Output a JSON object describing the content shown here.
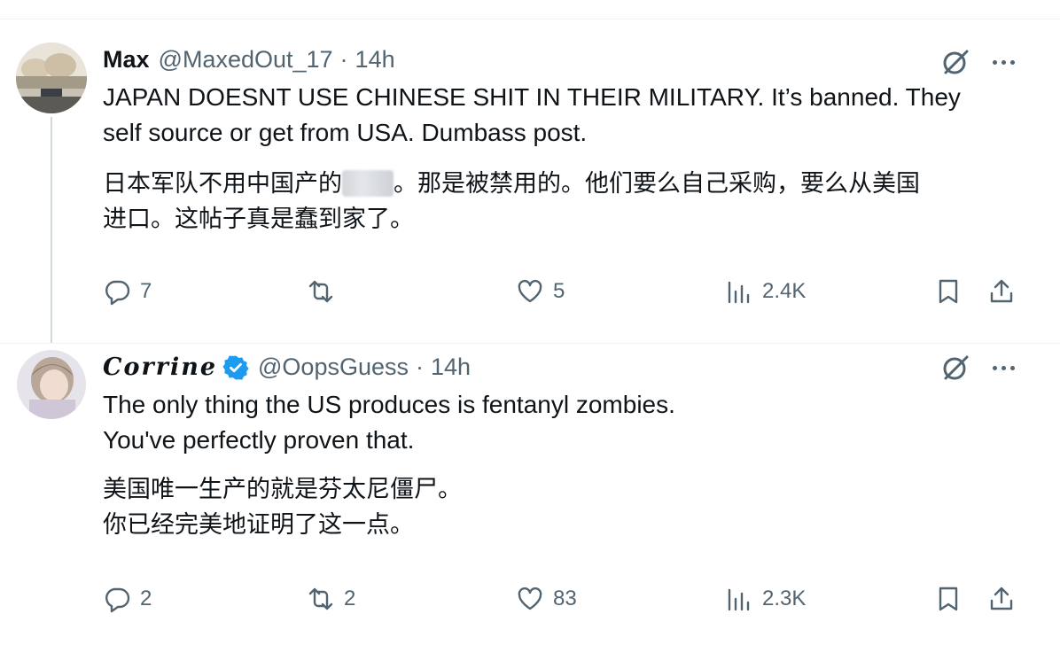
{
  "tweets": [
    {
      "name": "Max",
      "handle": "@MaxedOut_17",
      "separator": "·",
      "time": "14h",
      "verified": false,
      "text_en_lines": [
        "JAPAN DOESNT USE CHINESE SHIT IN THEIR MILITARY. It’s banned. They",
        "self source or get from USA. Dumbass post."
      ],
      "text_zh_part1": "日本军队不用中国产的",
      "text_zh_part2": "。那是被禁用的。他们要么自己采购，要么从美国",
      "text_zh_line2": "进口。这帖子真是蠢到家了。",
      "actions": {
        "replies": "7",
        "reposts": "",
        "likes": "5",
        "views": "2.4K"
      },
      "icons": [
        "grok-icon",
        "more-icon",
        "reply-icon",
        "repost-icon",
        "like-icon",
        "views-icon",
        "bookmark-icon",
        "share-icon"
      ]
    },
    {
      "name": "Corrine",
      "handle": "@OopsGuess",
      "separator": "·",
      "time": "14h",
      "verified": true,
      "text_en_lines": [
        "The only thing the US produces is fentanyl zombies.",
        "You've perfectly proven that."
      ],
      "text_zh_lines": [
        "美国唯一生产的就是芬太尼僵尸。",
        "你已经完美地证明了这一点。"
      ],
      "actions": {
        "replies": "2",
        "reposts": "2",
        "likes": "83",
        "views": "2.3K"
      }
    }
  ],
  "colors": {
    "text": "#0f1419",
    "secondary": "#536471",
    "verified": "#1d9bf0",
    "line": "#cfd9de"
  }
}
